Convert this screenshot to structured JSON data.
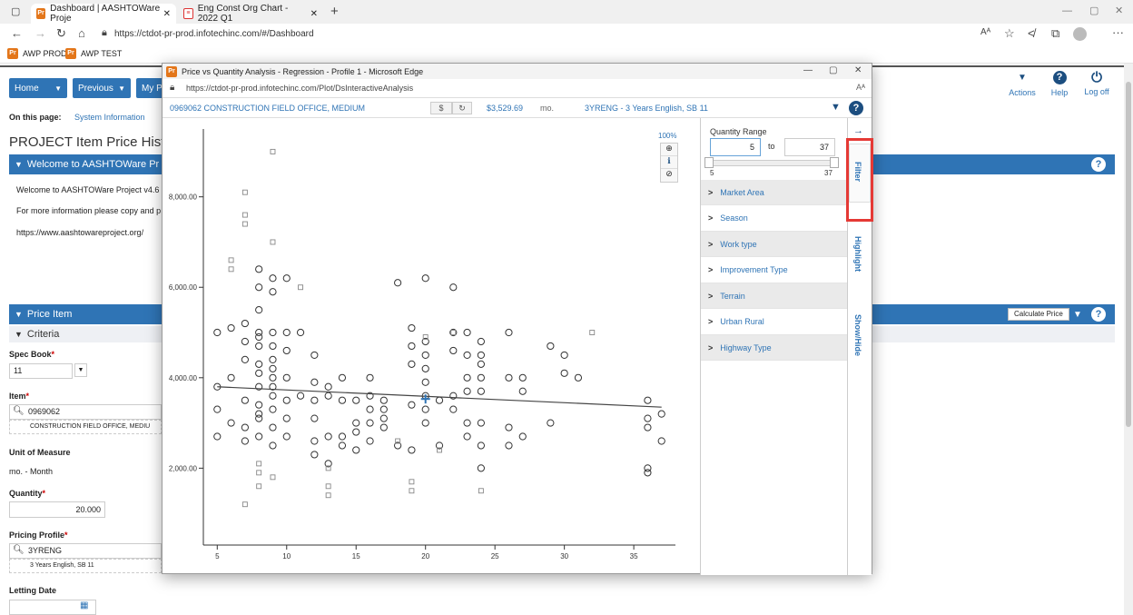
{
  "browser": {
    "tabs": [
      {
        "label": "Dashboard | AASHTOWare Proje",
        "active": true
      },
      {
        "label": "Eng Const Org Chart - 2022 Q1",
        "active": false
      }
    ],
    "url": "https://ctdot-pr-prod.infotechinc.com/#/Dashboard",
    "favorites": [
      "AWP PROD",
      "AWP TEST"
    ]
  },
  "nav": {
    "home": "Home",
    "previous": "Previous",
    "my": "My P",
    "actions": "Actions",
    "help": "Help",
    "logoff": "Log off"
  },
  "page": {
    "on_this_page": "On this page:",
    "system_information": "System Information",
    "title": "PROJECT Item Price Histor",
    "welcome_bar": "Welcome to AASHTOWare Pr",
    "welcome_text": "Welcome to AASHTOWare Project v4.6",
    "more_info": "For more information please copy and p",
    "site_url": "https://www.aashtowareproject.org/",
    "price_item_bar": "Price Item",
    "criteria": "Criteria",
    "calculate_price": "Calculate Price",
    "spec_book_label": "Spec Book",
    "spec_book_value": "11",
    "item_label": "Item",
    "item_value": "0969062",
    "item_desc": "CONSTRUCTION FIELD OFFICE, MEDIU",
    "uom_label": "Unit of Measure",
    "uom_value": "mo. - Month",
    "quantity_label": "Quantity",
    "quantity_value": "20.000",
    "pricing_profile_label": "Pricing Profile",
    "pricing_profile_value": "3YRENG",
    "pricing_profile_desc": "3 Years English, SB 11",
    "letting_date_label": "Letting Date"
  },
  "popup": {
    "title": "Price vs Quantity Analysis - Regression - Profile 1 - Microsoft Edge",
    "url": "https://ctdot-pr-prod.infotechinc.com/Plot/DsInteractiveAnalysis",
    "item": "0969062 CONSTRUCTION FIELD OFFICE, MEDIUM",
    "price": "$3,529.69",
    "unit": "mo.",
    "profile": "3YRENG - 3 Years English, SB 11",
    "zoom": "100%",
    "quantity_range_label": "Quantity Range",
    "range_from": "5",
    "range_to_word": "to",
    "range_to": "37",
    "range_min_label": "5",
    "range_max_label": "37",
    "filters": [
      "Market Area",
      "Season",
      "Work type",
      "Improvement Type",
      "Terrain",
      "Urban Rural",
      "Highway Type"
    ],
    "side_tabs": [
      "Filter",
      "Highlight",
      "Show/Hide"
    ]
  },
  "chart_data": {
    "type": "scatter",
    "xlim": [
      4,
      38
    ],
    "ylim": [
      300,
      9500
    ],
    "x_ticks": [
      5,
      10,
      15,
      20,
      25,
      30,
      35
    ],
    "y_ticks": [
      2000,
      4000,
      6000,
      8000
    ],
    "y_tick_labels": [
      "2,000.00",
      "4,000.00",
      "6,000.00",
      "8,000.00"
    ],
    "regression": {
      "x": [
        5,
        37
      ],
      "y": [
        3800,
        3350
      ]
    },
    "selected_point": {
      "x": 20,
      "y": 3530
    },
    "series": [
      {
        "marker": "circle",
        "points": [
          [
            5,
            3800
          ],
          [
            5,
            3300
          ],
          [
            5,
            2700
          ],
          [
            5,
            5000
          ],
          [
            6,
            5100
          ],
          [
            6,
            3000
          ],
          [
            6,
            4000
          ],
          [
            7,
            5200
          ],
          [
            7,
            4800
          ],
          [
            7,
            3500
          ],
          [
            7,
            2900
          ],
          [
            7,
            2600
          ],
          [
            7,
            4400
          ],
          [
            8,
            5000
          ],
          [
            8,
            4700
          ],
          [
            8,
            4300
          ],
          [
            8,
            3800
          ],
          [
            8,
            3400
          ],
          [
            8,
            3100
          ],
          [
            8,
            2700
          ],
          [
            8,
            5500
          ],
          [
            8,
            6000
          ],
          [
            8,
            6400
          ],
          [
            8,
            4900
          ],
          [
            8,
            4100
          ],
          [
            8,
            3200
          ],
          [
            9,
            5000
          ],
          [
            9,
            4700
          ],
          [
            9,
            4400
          ],
          [
            9,
            4000
          ],
          [
            9,
            3600
          ],
          [
            9,
            3300
          ],
          [
            9,
            2900
          ],
          [
            9,
            2500
          ],
          [
            9,
            6200
          ],
          [
            9,
            5900
          ],
          [
            9,
            4200
          ],
          [
            9,
            3800
          ],
          [
            10,
            5000
          ],
          [
            10,
            4600
          ],
          [
            10,
            4000
          ],
          [
            10,
            3500
          ],
          [
            10,
            3100
          ],
          [
            10,
            2700
          ],
          [
            10,
            6200
          ],
          [
            11,
            5000
          ],
          [
            11,
            3600
          ],
          [
            12,
            4500
          ],
          [
            12,
            3900
          ],
          [
            12,
            3500
          ],
          [
            12,
            3100
          ],
          [
            12,
            2600
          ],
          [
            12,
            2300
          ],
          [
            13,
            3800
          ],
          [
            13,
            3600
          ],
          [
            13,
            2700
          ],
          [
            13,
            2100
          ],
          [
            14,
            4000
          ],
          [
            14,
            3500
          ],
          [
            14,
            2700
          ],
          [
            14,
            2500
          ],
          [
            15,
            3500
          ],
          [
            15,
            3000
          ],
          [
            15,
            2800
          ],
          [
            15,
            2400
          ],
          [
            16,
            4000
          ],
          [
            16,
            3600
          ],
          [
            16,
            3300
          ],
          [
            16,
            3000
          ],
          [
            16,
            2600
          ],
          [
            17,
            3500
          ],
          [
            17,
            3300
          ],
          [
            17,
            3100
          ],
          [
            17,
            2900
          ],
          [
            18,
            2500
          ],
          [
            18,
            6100
          ],
          [
            19,
            5100
          ],
          [
            19,
            4700
          ],
          [
            19,
            4300
          ],
          [
            19,
            3400
          ],
          [
            19,
            2400
          ],
          [
            20,
            4800
          ],
          [
            20,
            4500
          ],
          [
            20,
            4200
          ],
          [
            20,
            3900
          ],
          [
            20,
            3600
          ],
          [
            20,
            3300
          ],
          [
            20,
            3000
          ],
          [
            20,
            6200
          ],
          [
            21,
            3500
          ],
          [
            21,
            2500
          ],
          [
            22,
            5000
          ],
          [
            22,
            4600
          ],
          [
            22,
            3600
          ],
          [
            22,
            3300
          ],
          [
            22,
            6000
          ],
          [
            23,
            5000
          ],
          [
            23,
            4500
          ],
          [
            23,
            4000
          ],
          [
            23,
            3700
          ],
          [
            23,
            3000
          ],
          [
            23,
            2700
          ],
          [
            24,
            4800
          ],
          [
            24,
            4500
          ],
          [
            24,
            4300
          ],
          [
            24,
            4000
          ],
          [
            24,
            3700
          ],
          [
            24,
            3000
          ],
          [
            24,
            2500
          ],
          [
            24,
            2000
          ],
          [
            26,
            5000
          ],
          [
            26,
            4000
          ],
          [
            26,
            2900
          ],
          [
            26,
            2500
          ],
          [
            27,
            4000
          ],
          [
            27,
            3700
          ],
          [
            27,
            2700
          ],
          [
            29,
            3000
          ],
          [
            29,
            4700
          ],
          [
            30,
            4500
          ],
          [
            30,
            4100
          ],
          [
            31,
            4000
          ],
          [
            36,
            3500
          ],
          [
            36,
            3100
          ],
          [
            36,
            2900
          ],
          [
            36,
            2000
          ],
          [
            36,
            1900
          ],
          [
            37,
            3200
          ],
          [
            37,
            2600
          ]
        ]
      },
      {
        "marker": "square",
        "points": [
          [
            6,
            6600
          ],
          [
            6,
            6400
          ],
          [
            7,
            7600
          ],
          [
            7,
            7400
          ],
          [
            7,
            8100
          ],
          [
            7,
            1200
          ],
          [
            8,
            2100
          ],
          [
            8,
            1900
          ],
          [
            8,
            1600
          ],
          [
            9,
            9000
          ],
          [
            9,
            7000
          ],
          [
            9,
            1800
          ],
          [
            11,
            6000
          ],
          [
            13,
            2000
          ],
          [
            13,
            1600
          ],
          [
            13,
            1400
          ],
          [
            18,
            2600
          ],
          [
            19,
            1700
          ],
          [
            19,
            1500
          ],
          [
            20,
            4900
          ],
          [
            21,
            2400
          ],
          [
            22,
            5000
          ],
          [
            24,
            1500
          ],
          [
            32,
            5000
          ]
        ]
      }
    ]
  },
  "colors": {
    "accent": "#2f74b5",
    "highlight": "#e53935"
  },
  "icons": [
    "back-icon",
    "forward-icon",
    "refresh-icon",
    "home-icon",
    "lock-icon",
    "dropdown-icon",
    "help-icon",
    "power-icon",
    "zoom-icon",
    "info-icon",
    "reset-icon",
    "arrow-right-icon",
    "calendar-icon",
    "search-icon"
  ]
}
